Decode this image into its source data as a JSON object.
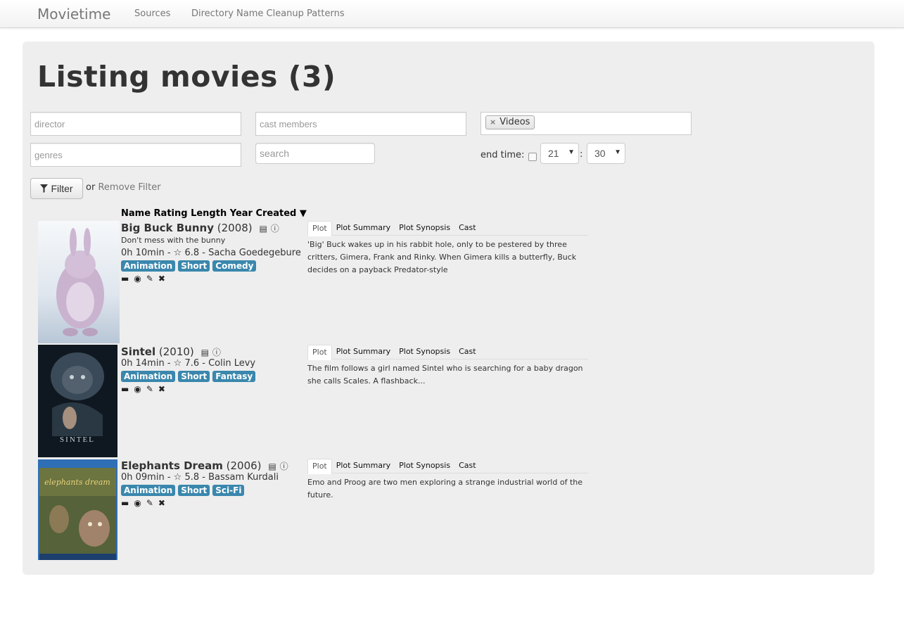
{
  "nav": {
    "brand": "Movietime",
    "links": [
      "Sources",
      "Directory Name Cleanup Patterns"
    ]
  },
  "page_title": "Listing movies (3)",
  "filters": {
    "director_placeholder": "director",
    "cast_placeholder": "cast members",
    "genres_placeholder": "genres",
    "search_placeholder": "search",
    "source_tag": "Videos",
    "end_time_label": "end time:",
    "end_hour": "21",
    "end_minute": "30",
    "colon": ":",
    "filter_button": "Filter",
    "or_text": "or",
    "remove_filter": "Remove Filter"
  },
  "sort_header": "Name Rating Length Year Created ▼",
  "tabs": [
    "Plot",
    "Plot Summary",
    "Plot Synopsis",
    "Cast"
  ],
  "movies": [
    {
      "name": "Big Buck Bunny",
      "year": "(2008)",
      "tagline": "Don't mess with the bunny",
      "meta": "0h 10min - ☆ 6.8 - Sacha Goedegebure",
      "genres": [
        "Animation",
        "Short",
        "Comedy"
      ],
      "plot": "'Big' Buck wakes up in his rabbit hole, only to be pestered by three critters, Gimera, Frank and Rinky. When Gimera kills a butterfly, Buck decides on a payback Predator-style"
    },
    {
      "name": "Sintel",
      "year": "(2010)",
      "tagline": "",
      "meta": "0h 14min - ☆ 7.6 - Colin Levy",
      "genres": [
        "Animation",
        "Short",
        "Fantasy"
      ],
      "plot": "The film follows a girl named Sintel who is searching for a baby dragon she calls Scales. A flashback...",
      "poster_text": "SINTEL"
    },
    {
      "name": "Elephants Dream",
      "year": "(2006)",
      "tagline": "",
      "meta": "0h 09min - ☆ 5.8 - Bassam Kurdali",
      "genres": [
        "Animation",
        "Short",
        "Sci-Fi"
      ],
      "plot": "Emo and Proog are two men exploring a strange industrial world of the future.",
      "poster_text": "elephants dream"
    }
  ]
}
